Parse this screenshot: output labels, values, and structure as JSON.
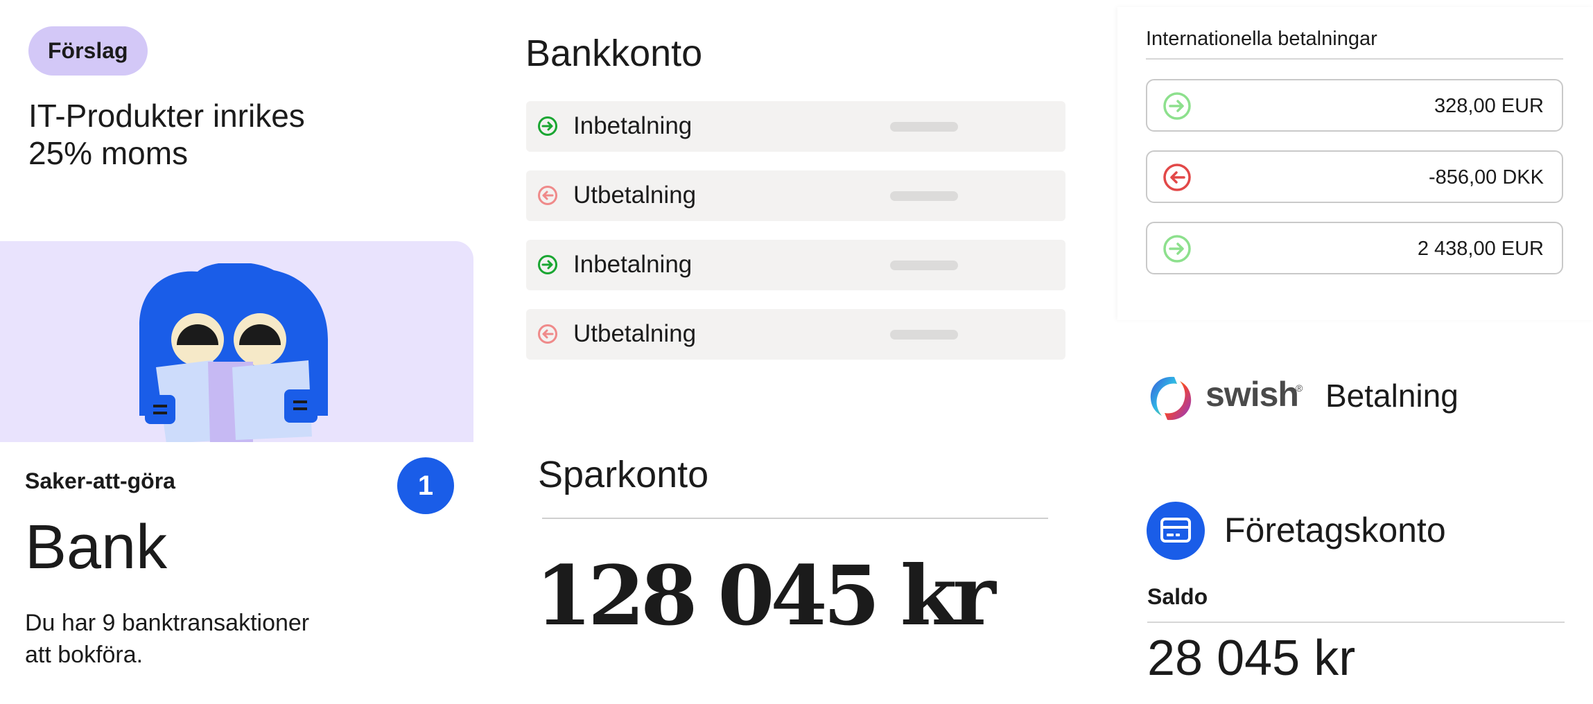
{
  "suggestion": {
    "chip_label": "Förslag",
    "line1": "IT-Produkter inrikes",
    "line2": "25% moms"
  },
  "todo": {
    "title": "Saker-att-göra",
    "badge_count": "1",
    "heading": "Bank",
    "desc_line1": "Du har 9 banktransaktioner",
    "desc_line2": "att bokföra."
  },
  "bank_account": {
    "title": "Bankkonto",
    "transactions": [
      {
        "label": "Inbetalning",
        "direction": "in",
        "icon": "arrow-right-circle-icon"
      },
      {
        "label": "Utbetalning",
        "direction": "out",
        "icon": "arrow-left-circle-icon"
      },
      {
        "label": "Inbetalning",
        "direction": "in",
        "icon": "arrow-right-circle-icon"
      },
      {
        "label": "Utbetalning",
        "direction": "out",
        "icon": "arrow-left-circle-icon"
      }
    ]
  },
  "savings": {
    "title": "Sparkonto",
    "amount": "128 045 kr"
  },
  "international": {
    "title": "Internationella betalningar",
    "payments": [
      {
        "amount": "328,00 EUR",
        "direction": "in"
      },
      {
        "amount": "-856,00 DKK",
        "direction": "out"
      },
      {
        "amount": "2 438,00 EUR",
        "direction": "in"
      }
    ]
  },
  "swish": {
    "brand": "swish",
    "registered_mark": "®",
    "label": "Betalning"
  },
  "business_account": {
    "title": "Företagskonto",
    "balance_label": "Saldo",
    "balance_amount": "28 045 kr"
  },
  "colors": {
    "accent_blue": "#1a5de8",
    "chip_purple": "#d3c8f7",
    "hero_bg": "#e9e3fd",
    "in_green": "#1aa632",
    "out_red": "#ef8a8a",
    "intl_in_green": "#8de08d",
    "intl_out_red": "#e24848"
  }
}
